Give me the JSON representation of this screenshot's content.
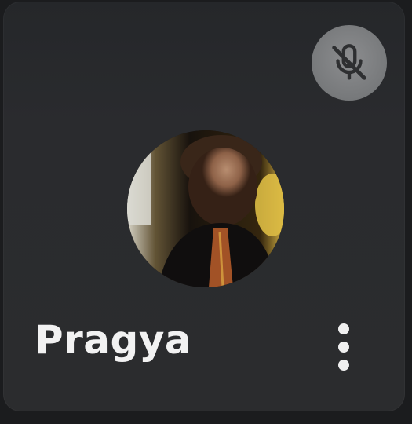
{
  "participant": {
    "name": "Pragya",
    "mic_status_icon": "mic-off-icon",
    "avatar": "profile-photo",
    "menu_icon": "more-vert-icon"
  },
  "colors": {
    "tile_background": "#2b2c2e",
    "badge_background": "#808284",
    "name_text": "#f2f2f2"
  }
}
